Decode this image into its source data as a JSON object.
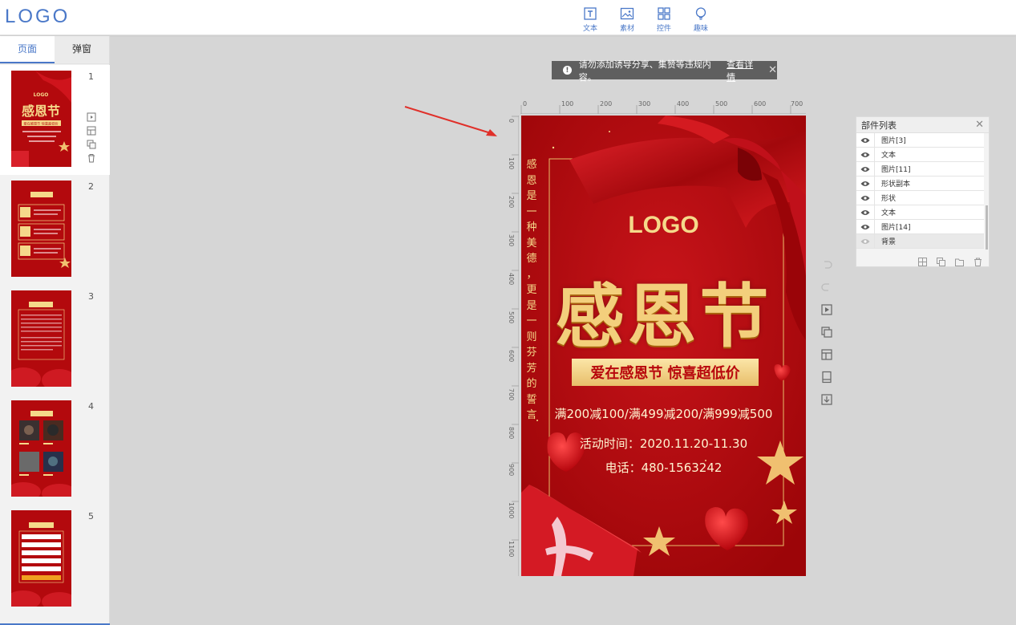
{
  "app": {
    "logo": "LOGO"
  },
  "toolbar": {
    "items": [
      {
        "label": "文本",
        "icon": "text-icon"
      },
      {
        "label": "素材",
        "icon": "image-icon"
      },
      {
        "label": "控件",
        "icon": "widget-icon"
      },
      {
        "label": "趣味",
        "icon": "bulb-icon"
      }
    ]
  },
  "sidebar": {
    "tabs": [
      {
        "label": "页面"
      },
      {
        "label": "弹窗"
      }
    ],
    "pages": [
      {
        "number": "1"
      },
      {
        "number": "2"
      },
      {
        "number": "3"
      },
      {
        "number": "4"
      },
      {
        "number": "5"
      }
    ],
    "thumb_texts": {
      "t1_logo": "LOGO",
      "t1_title": "感恩节",
      "t1_sub": "爱在感恩节 惊喜超低价"
    }
  },
  "notice": {
    "text": "请勿添加诱导分享、集赞等违规内容。",
    "link": "查看详情"
  },
  "rulers": {
    "horizontal": [
      "0",
      "100",
      "200",
      "300",
      "400",
      "500",
      "600",
      "700"
    ],
    "vertical": [
      "0",
      "100",
      "200",
      "300",
      "400",
      "500",
      "600",
      "700",
      "800",
      "900",
      "1000",
      "1100"
    ]
  },
  "poster": {
    "vertical_text": [
      "感",
      "恩",
      "是",
      "一",
      "种",
      "美",
      "德",
      "，",
      "更",
      "是",
      "一",
      "则",
      "芬",
      "芳",
      "的",
      "誓",
      "言"
    ],
    "logo": "LOGO",
    "title": "感恩节",
    "slogan": "爱在感恩节 惊喜超低价",
    "promo": "满200减100/满499减200/满999减500",
    "time": "活动时间：2020.11.20-11.30",
    "phone": "电话：480-1563242"
  },
  "layers_panel": {
    "title": "部件列表",
    "items": [
      {
        "name": "图片[3]"
      },
      {
        "name": "文本"
      },
      {
        "name": "图片[11]"
      },
      {
        "name": "形状副本"
      },
      {
        "name": "形状"
      },
      {
        "name": "文本"
      },
      {
        "name": "图片[14]"
      },
      {
        "name": "背景"
      }
    ]
  },
  "colors": {
    "accent": "#4a78c8",
    "poster_red": "#b30a0c",
    "gold": "#f5d98a"
  }
}
